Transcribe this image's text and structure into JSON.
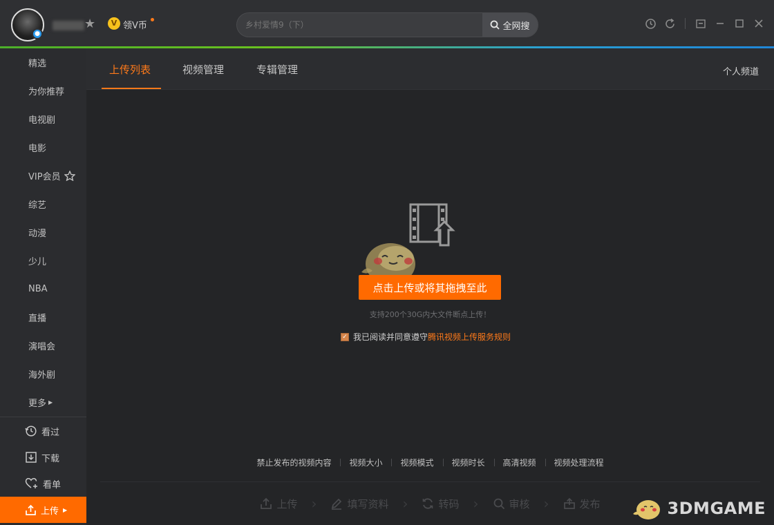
{
  "header": {
    "vcoin_icon_text": "V",
    "vcoin_label": "领V币",
    "search": {
      "placeholder": "乡村爱情9（下）",
      "button_label": "全网搜"
    },
    "window_icons": [
      "history-icon",
      "refresh-icon",
      "mini-mode-icon",
      "minimize-icon",
      "maximize-icon",
      "close-icon"
    ]
  },
  "sidebar": {
    "items": [
      {
        "label": "精选"
      },
      {
        "label": "为你推荐"
      },
      {
        "label": "电视剧"
      },
      {
        "label": "电影"
      },
      {
        "label": "VIP会员"
      },
      {
        "label": "综艺"
      },
      {
        "label": "动漫"
      },
      {
        "label": "少儿"
      },
      {
        "label": "NBA"
      },
      {
        "label": "直播"
      },
      {
        "label": "演唱会"
      },
      {
        "label": "海外剧"
      },
      {
        "label": "更多"
      }
    ],
    "bottom": [
      {
        "label": "看过",
        "icon": "history-icon"
      },
      {
        "label": "下载",
        "icon": "download-icon"
      },
      {
        "label": "看单",
        "icon": "heart-plus-icon"
      }
    ],
    "upload_label": "上传"
  },
  "tabs": {
    "items": [
      {
        "label": "上传列表",
        "active": true
      },
      {
        "label": "视频管理",
        "active": false
      },
      {
        "label": "专辑管理",
        "active": false
      }
    ],
    "personal_channel": "个人频道"
  },
  "main": {
    "upload_button": "点击上传或将其拖拽至此",
    "hint": "支持200个30G内大文件断点上传！",
    "agree_text": "我已阅读并同意遵守",
    "agree_link": "腾讯视频上传服务规则",
    "agree_checked": true,
    "footer_links": [
      "禁止发布的视频内容",
      "视频大小",
      "视频模式",
      "视频时长",
      "高清视频",
      "视频处理流程"
    ],
    "steps": [
      "上传",
      "填写资料",
      "转码",
      "审核",
      "发布"
    ]
  },
  "watermark": "3DMGAME",
  "colors": {
    "accent": "#ff6a00",
    "link": "#ff7a1a",
    "vcoin": "#f7c21c"
  }
}
